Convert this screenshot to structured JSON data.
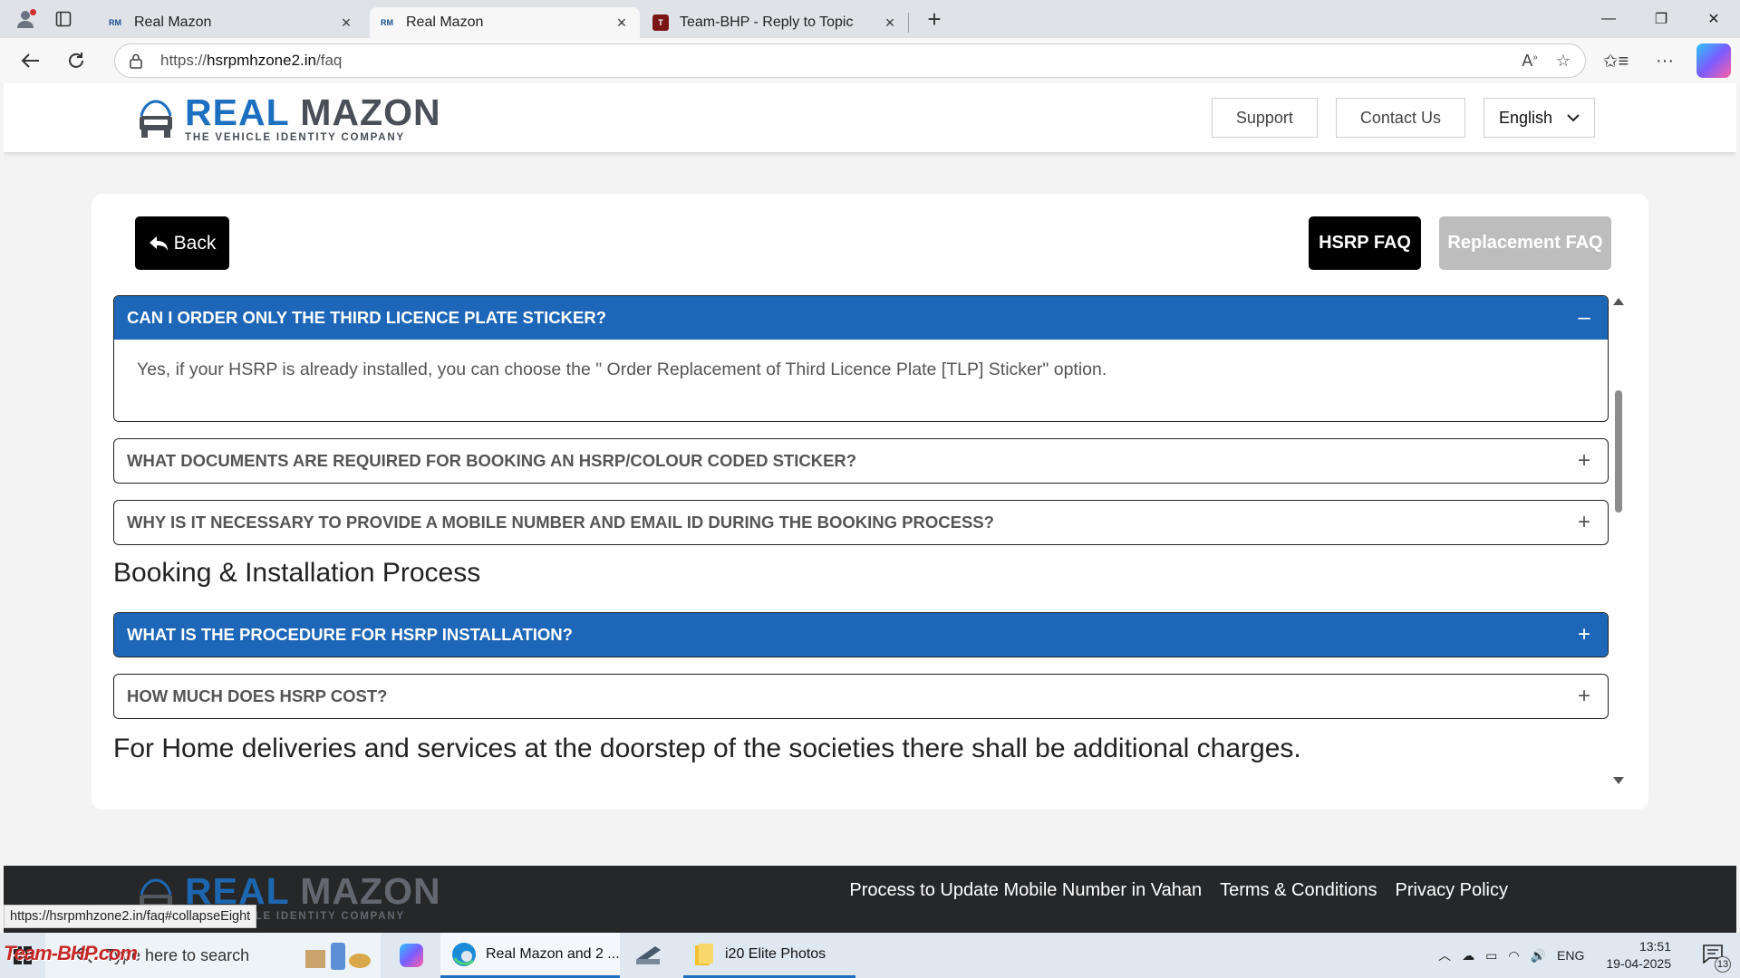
{
  "browser": {
    "tabs": [
      {
        "favicon": "RM",
        "title": "Real Mazon"
      },
      {
        "favicon": "RM",
        "title": "Real Mazon"
      },
      {
        "favicon": "T",
        "title": "Team-BHP - Reply to Topic"
      }
    ],
    "url_prefix": "https://",
    "url_host": "hsrpmhzone2.in",
    "url_path": "/faq",
    "status_url": "https://hsrpmhzone2.in/faq#collapseEight"
  },
  "site": {
    "logo_name_a": "REAL",
    "logo_name_b": " MAZON",
    "logo_tagline": "THE VEHICLE IDENTITY COMPANY",
    "header_buttons": {
      "support": "Support",
      "contact": "Contact Us",
      "language": "English"
    },
    "back_label": "Back",
    "hsrp_faq_label": "HSRP FAQ",
    "replacement_faq_label": "Replacement FAQ",
    "faqs": [
      {
        "question": "CAN I ORDER ONLY THE THIRD LICENCE PLATE STICKER?",
        "answer": "Yes, if your HSRP is already installed, you can choose the \" Order Replacement of Third Licence Plate [TLP] Sticker\" option.",
        "symbol": "–"
      },
      {
        "question": "WHAT DOCUMENTS ARE REQUIRED FOR BOOKING AN HSRP/COLOUR CODED STICKER?",
        "symbol": "+"
      },
      {
        "question": "WHY IS IT NECESSARY TO PROVIDE A MOBILE NUMBER AND EMAIL ID DURING THE BOOKING PROCESS?",
        "symbol": "+"
      },
      {
        "question": "WHAT IS THE PROCEDURE FOR HSRP INSTALLATION?",
        "symbol": "+"
      },
      {
        "question": "HOW MUCH DOES HSRP COST?",
        "symbol": "+"
      }
    ],
    "section_title": "Booking & Installation Process",
    "note": "For Home deliveries and services at the doorstep of the societies there shall be additional charges.",
    "footer_links": [
      "Process to Update Mobile Number in Vahan",
      "Terms & Conditions",
      "Privacy Policy"
    ]
  },
  "taskbar": {
    "search_placeholder": "Type here to search",
    "apps": [
      {
        "label": "Real Mazon and 2 ..."
      },
      {
        "label": "i20 Elite Photos"
      }
    ],
    "tray_lang": "ENG",
    "time": "13:51",
    "date": "19-04-2025",
    "notifications": "13"
  },
  "watermark": {
    "text": "Team-BHP.com"
  },
  "colors": {
    "accent_blue": "#1d66b8",
    "brand_blue": "#1d6fc0",
    "footer_bg": "#262729"
  }
}
